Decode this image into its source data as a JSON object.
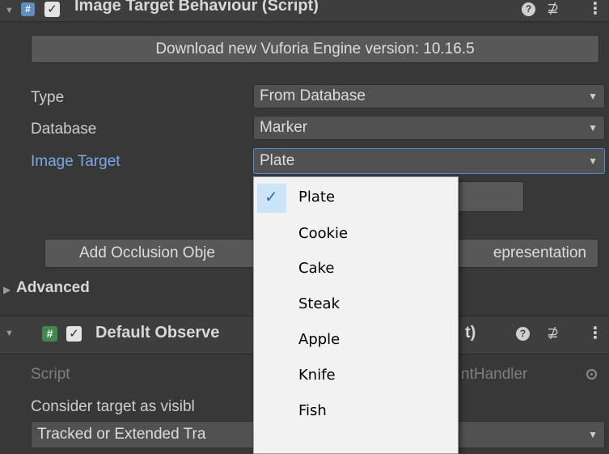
{
  "component1": {
    "title": "Image Target Behaviour (Script)",
    "icon": "csharp-script-icon",
    "enabled": true
  },
  "download_button": {
    "label": "Download new Vuforia Engine version: 10.16.5"
  },
  "fields": {
    "type": {
      "label": "Type",
      "value": "From Database"
    },
    "database": {
      "label": "Database",
      "value": "Marker"
    },
    "image_target": {
      "label": "Image Target",
      "value": "Plate"
    }
  },
  "buttons": {
    "add_occlusion": "Add Occlusion Obje",
    "representation": "epresentation"
  },
  "advanced": {
    "label": "Advanced"
  },
  "component2": {
    "title_visible_left": "Default Observe",
    "title_visible_right": "t)",
    "icon": "hash-script-icon",
    "enabled": true
  },
  "script_field": {
    "label": "Script",
    "value_visible": "ntHandler"
  },
  "consider_label": "Consider target as visibl",
  "tracked_dropdown": {
    "value_visible": "Tracked or Extended Tra"
  },
  "popup": {
    "items": [
      "Plate",
      "Cookie",
      "Cake",
      "Steak",
      "Apple",
      "Knife",
      "Fish"
    ],
    "selected": "Plate",
    "check_glyph": "✓"
  },
  "glyphs": {
    "fold_down": "▼",
    "fold_right": "▶",
    "checkbox": "✓",
    "cs": "c#",
    "hash": "#",
    "help": "?",
    "preset": "⊉",
    "menu": "⋮",
    "dropdown_arrow": "▼"
  },
  "colors": {
    "panel_bg": "#383838",
    "header_bg": "#3e3e3e",
    "focus_blue": "#4d8ed9",
    "label_blue": "#7ba7e7",
    "popup_bg": "#f2f2f2",
    "popup_highlight": "#cce4f7"
  }
}
